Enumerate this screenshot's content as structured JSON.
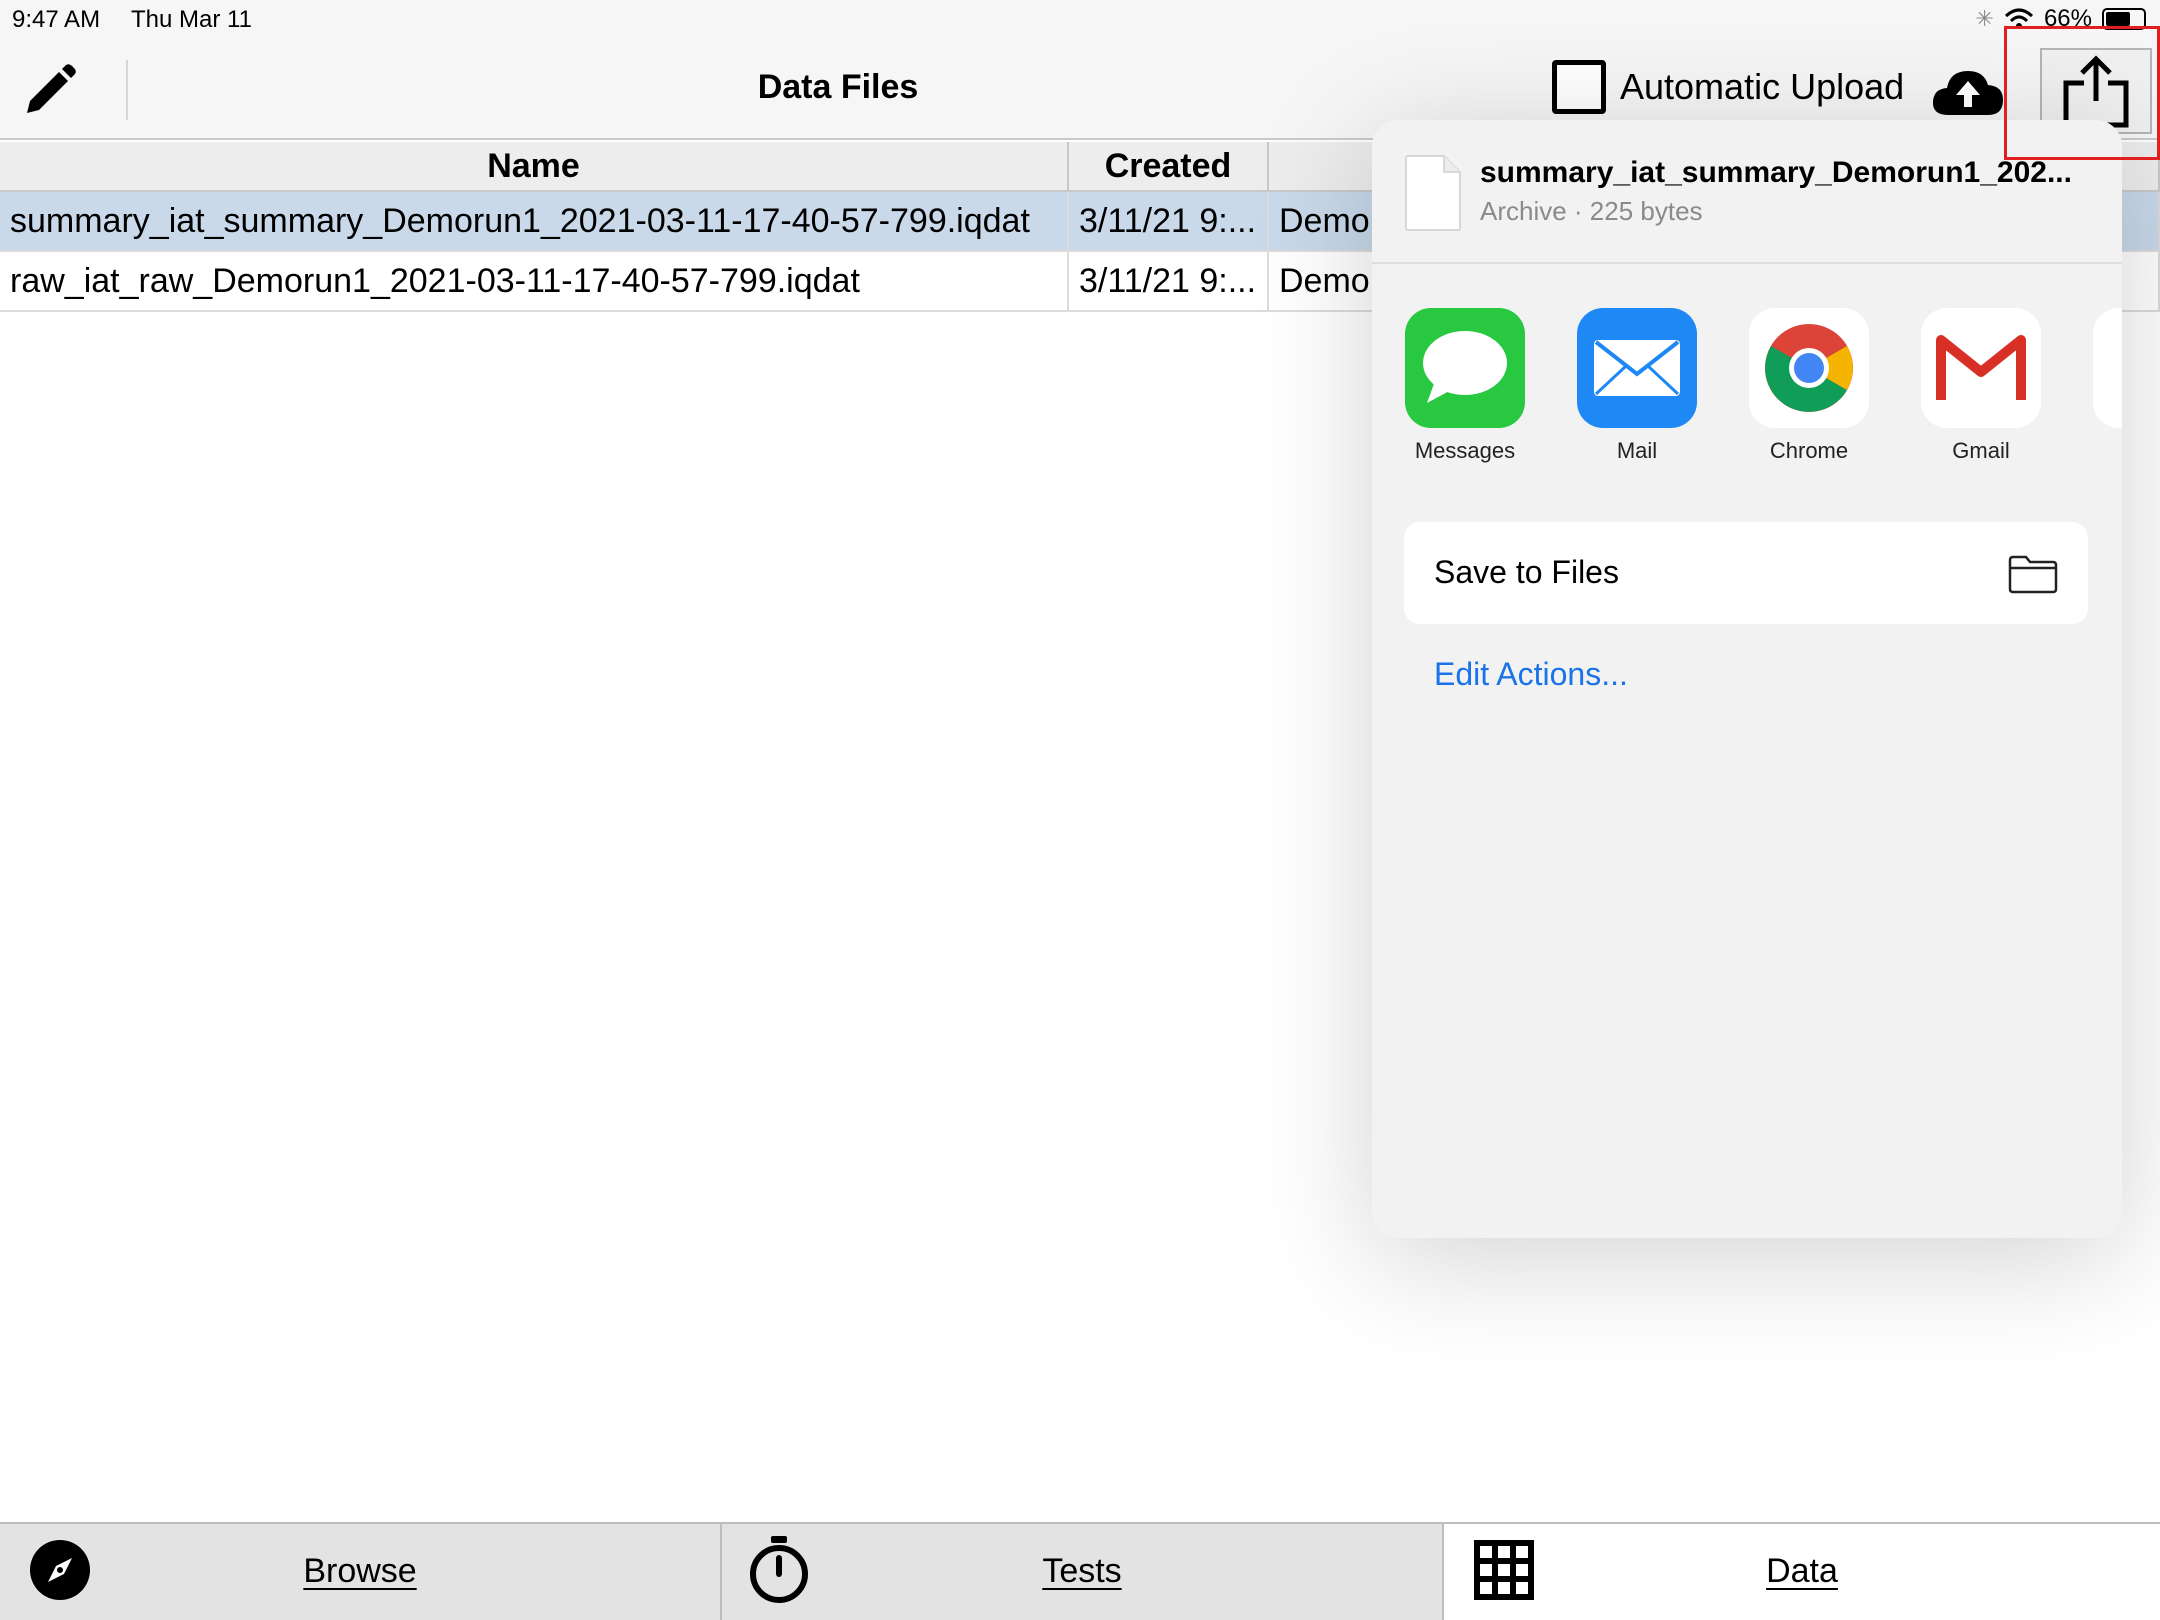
{
  "status_bar": {
    "time": "9:47 AM",
    "date": "Thu Mar 11",
    "battery": "66%",
    "battery_level": 0.66
  },
  "toolbar": {
    "title": "Data Files",
    "edit_icon": "pencil-icon",
    "automatic_upload_label": "Automatic Upload",
    "automatic_upload_checked": false,
    "cloud_icon": "cloud-upload-icon",
    "share_icon": "share-icon"
  },
  "table": {
    "columns": [
      "Name",
      "Created",
      ""
    ],
    "rows": [
      {
        "name": "summary_iat_summary_Demorun1_2021-03-11-17-40-57-799.iqdat",
        "created": "3/11/21 9:...",
        "third": "Demor",
        "selected": true
      },
      {
        "name": "raw_iat_raw_Demorun1_2021-03-11-17-40-57-799.iqdat",
        "created": "3/11/21 9:...",
        "third": "Demor",
        "selected": false
      }
    ]
  },
  "share_sheet": {
    "file_name": "summary_iat_summary_Demorun1_202...",
    "file_meta": "Archive · 225 bytes",
    "apps": [
      {
        "label": "Messages",
        "icon": "messages-icon",
        "color": "#28c840"
      },
      {
        "label": "Mail",
        "icon": "mail-icon",
        "color": "#1e88f5"
      },
      {
        "label": "Chrome",
        "icon": "chrome-icon",
        "color": "#ffffff"
      },
      {
        "label": "Gmail",
        "icon": "gmail-icon",
        "color": "#ffffff"
      }
    ],
    "save_to_files": "Save to Files",
    "edit_actions": "Edit Actions..."
  },
  "tab_bar": {
    "tabs": [
      {
        "label": "Browse",
        "icon": "compass-icon",
        "active": false
      },
      {
        "label": "Tests",
        "icon": "stopwatch-icon",
        "active": false
      },
      {
        "label": "Data",
        "icon": "grid-icon",
        "active": true
      }
    ]
  },
  "colors": {
    "highlight_frame": "#e02020",
    "selected_row": "#c9d9ea",
    "link_blue": "#1a73e8"
  }
}
